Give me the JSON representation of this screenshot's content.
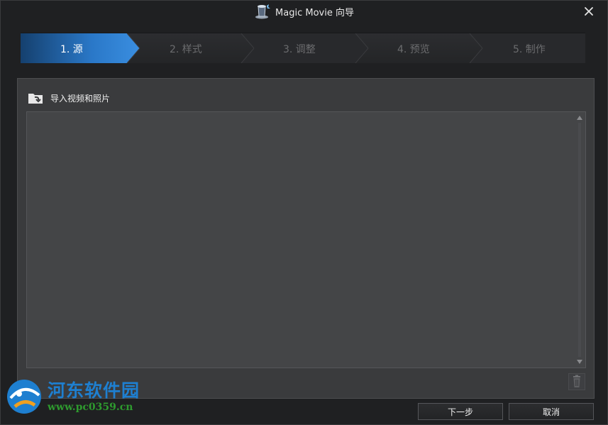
{
  "window": {
    "title": "Magic Movie 向导",
    "app_icon": "magic-hat-icon",
    "close_icon": "close-icon"
  },
  "steps": [
    {
      "label": "1. 源",
      "active": true
    },
    {
      "label": "2. 样式",
      "active": false
    },
    {
      "label": "3. 调整",
      "active": false
    },
    {
      "label": "4. 预览",
      "active": false
    },
    {
      "label": "5. 制作",
      "active": false
    }
  ],
  "panel": {
    "import_label": "导入视频和照片",
    "import_icon": "folder-import-icon",
    "delete_icon": "trash-icon"
  },
  "buttons": {
    "next": "下一步",
    "cancel": "取消"
  },
  "watermark": {
    "title": "河东软件园",
    "url": "www.pc0359.cn"
  },
  "colors": {
    "accent": "#2f7fd0",
    "background": "#1f2022",
    "panel": "#3a3b3d"
  }
}
